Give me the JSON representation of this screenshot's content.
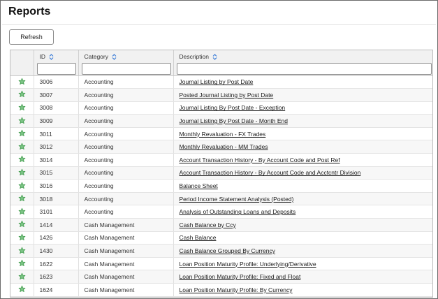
{
  "page": {
    "title": "Reports"
  },
  "toolbar": {
    "refresh_label": "Refresh"
  },
  "table": {
    "columns": [
      {
        "key": "id",
        "label": "ID",
        "sortable": true
      },
      {
        "key": "category",
        "label": "Category",
        "sortable": true
      },
      {
        "key": "description",
        "label": "Description",
        "sortable": true
      }
    ],
    "filters": {
      "id": "",
      "category": "",
      "description": ""
    },
    "rows": [
      {
        "favorite": true,
        "id": "3006",
        "category": "Accounting",
        "description": "Journal Listing by Post Date"
      },
      {
        "favorite": true,
        "id": "3007",
        "category": "Accounting",
        "description": "Posted Journal Listing by Post Date"
      },
      {
        "favorite": true,
        "id": "3008",
        "category": "Accounting",
        "description": "Journal Listing By Post Date - Exception"
      },
      {
        "favorite": true,
        "id": "3009",
        "category": "Accounting",
        "description": "Journal Listing By Post Date - Month End"
      },
      {
        "favorite": true,
        "id": "3011",
        "category": "Accounting",
        "description": "Monthly Revaluation - FX Trades"
      },
      {
        "favorite": true,
        "id": "3012",
        "category": "Accounting",
        "description": "Monthly Revaluation - MM Trades"
      },
      {
        "favorite": true,
        "id": "3014",
        "category": "Accounting",
        "description": "Account Transaction History - By Account Code and Post Ref"
      },
      {
        "favorite": true,
        "id": "3015",
        "category": "Accounting",
        "description": "Account Transaction History - By Account Code and Acctcntr Division"
      },
      {
        "favorite": true,
        "id": "3016",
        "category": "Accounting",
        "description": "Balance Sheet"
      },
      {
        "favorite": true,
        "id": "3018",
        "category": "Accounting",
        "description": "Period Income Statement Analysis (Posted)"
      },
      {
        "favorite": true,
        "id": "3101",
        "category": "Accounting",
        "description": "Analysis of Outstanding Loans and Deposits"
      },
      {
        "favorite": true,
        "id": "1414",
        "category": "Cash Management",
        "description": "Cash Balance by Ccy"
      },
      {
        "favorite": true,
        "id": "1426",
        "category": "Cash Management",
        "description": "Cash Balance"
      },
      {
        "favorite": true,
        "id": "1430",
        "category": "Cash Management",
        "description": "Cash Balance Grouped By Currency"
      },
      {
        "favorite": true,
        "id": "1622",
        "category": "Cash Management",
        "description": "Loan Position Maturity Profile: Underlying/Derivative"
      },
      {
        "favorite": true,
        "id": "1623",
        "category": "Cash Management",
        "description": "Loan Position Maturity Profile: Fixed and Float"
      },
      {
        "favorite": true,
        "id": "1624",
        "category": "Cash Management",
        "description": "Loan Position Maturity Profile: By Currency"
      }
    ]
  },
  "icons": {
    "favorite": "star-icon",
    "sort": "sort-icon"
  },
  "colors": {
    "star_stroke": "#3e9a4a",
    "star_fill": "#7cc486"
  }
}
